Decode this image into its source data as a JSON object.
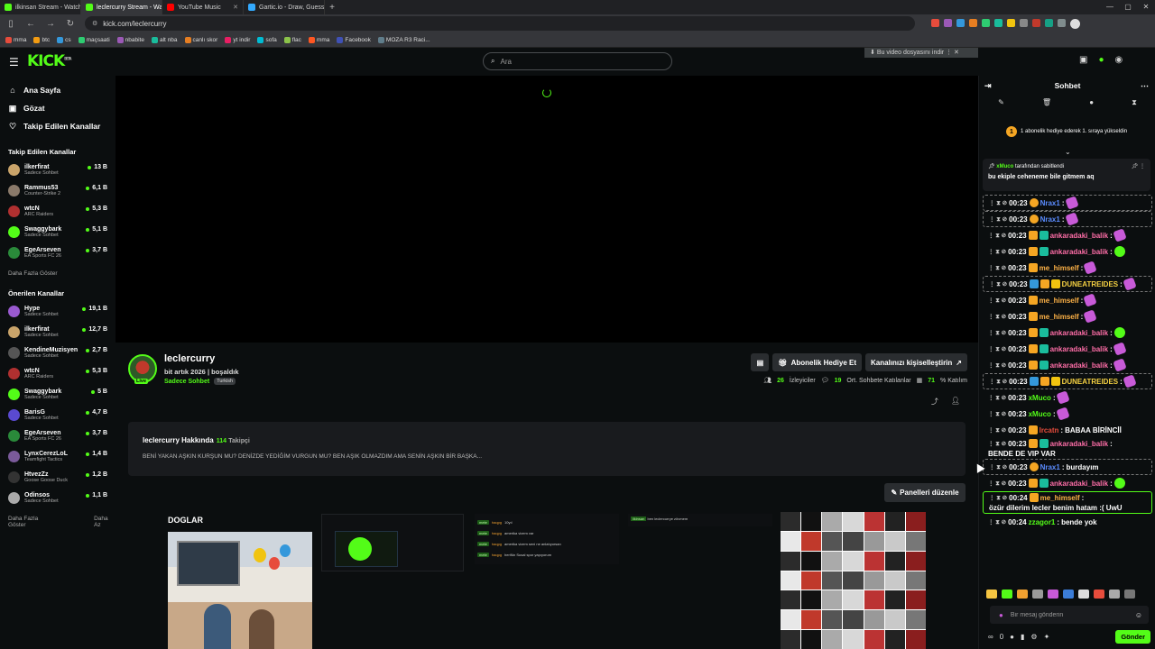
{
  "browser": {
    "tabs": [
      {
        "title": "ilkinsan Stream - Watch Live",
        "color": "#53fc18",
        "active": false
      },
      {
        "title": "leclercurry Stream - Watch",
        "color": "#53fc18",
        "active": true
      },
      {
        "title": "YouTube Music",
        "color": "#ff0000",
        "active": false
      },
      {
        "title": "Gartic.io - Draw, Guess, WI",
        "color": "#33aaff",
        "active": false
      }
    ],
    "url": "kick.com/leclercurry",
    "bookmarks": [
      "mma",
      "btc",
      "cs",
      "maçsaati",
      "nbabite",
      "alt nba",
      "canlı skor",
      "yt indir",
      "sofa",
      "flac",
      "mma",
      "Facebook",
      "MOZA R3 Raci..."
    ],
    "download_notice": "Bu video dosyasını indir"
  },
  "header": {
    "logo": "KICK",
    "logo_sup": "BETA",
    "search_placeholder": "Ara"
  },
  "sidebar": {
    "nav": [
      {
        "label": "Ana Sayfa",
        "icon": "home-icon",
        "glyph": "⌂"
      },
      {
        "label": "Gözat",
        "icon": "browse-icon",
        "glyph": "▣"
      },
      {
        "label": "Takip Edilen Kanallar",
        "icon": "heart-icon",
        "glyph": "♡"
      }
    ],
    "followed_title": "Takip Edilen Kanallar",
    "followed": [
      {
        "name": "ilkerfirat",
        "cat": "Sadece Sohbet",
        "viewers": "13 B",
        "color": "#c9a46a"
      },
      {
        "name": "Rammus53",
        "cat": "Counter-Strike 2",
        "viewers": "6,1 B",
        "color": "#8a7a6a"
      },
      {
        "name": "wtcN",
        "cat": "ARC Raiders",
        "viewers": "5,3 B",
        "color": "#b03030"
      },
      {
        "name": "Swaggybark",
        "cat": "Sadece Sohbet",
        "viewers": "5,1 B",
        "color": "#53fc18"
      },
      {
        "name": "EgeArseven",
        "cat": "EA Sports FC 26",
        "viewers": "3,7 B",
        "color": "#2a8a3a"
      }
    ],
    "show_more": "Daha Fazla Göster",
    "recommended_title": "Önerilen Kanallar",
    "recommended": [
      {
        "name": "Hype",
        "cat": "Sadece Sohbet",
        "viewers": "19,1 B",
        "color": "#9a5ad0"
      },
      {
        "name": "ilkerfirat",
        "cat": "Sadece Sohbet",
        "viewers": "12,7 B",
        "color": "#c9a46a"
      },
      {
        "name": "KendineMuzisyen",
        "cat": "Sadece Sohbet",
        "viewers": "2,7 B",
        "color": "#555555"
      },
      {
        "name": "wtcN",
        "cat": "ARC Raiders",
        "viewers": "5,3 B",
        "color": "#b03030"
      },
      {
        "name": "Swaggybark",
        "cat": "Sadece Sohbet",
        "viewers": "5 B",
        "color": "#53fc18"
      },
      {
        "name": "BarisG",
        "cat": "Sadece Sohbet",
        "viewers": "4,7 B",
        "color": "#5a4ad0"
      },
      {
        "name": "EgeArseven",
        "cat": "EA Sports FC 26",
        "viewers": "3,7 B",
        "color": "#2a8a3a"
      },
      {
        "name": "LynxCerezLoL",
        "cat": "Teamfight Tactics",
        "viewers": "1,4 B",
        "color": "#7a5a9a"
      },
      {
        "name": "HtvezZz",
        "cat": "Goose Goose Duck",
        "viewers": "1,2 B",
        "color": "#333333"
      },
      {
        "name": "Odinsos",
        "cat": "Sadece Sohbet",
        "viewers": "1,1 B",
        "color": "#aaaaaa"
      }
    ],
    "show_more2": "Daha Fazla Göster",
    "show_less": "Daha Az"
  },
  "channel": {
    "name": "leclercurry",
    "live": "Live",
    "stream_title": "bit artık 2026 | boşaldık",
    "category": "Sadece Sohbet",
    "tag": "Turkish",
    "buttons": {
      "gift": "Abonelik Hediye Et",
      "customize": "Kanalınızı kişiselleştirin"
    },
    "stats": {
      "viewers": "26",
      "viewers_label": "İzleyiciler",
      "chatters": "19",
      "chatters_label": "Ort. Sohbete Katılanlar",
      "participation": "71",
      "participation_label": "% Katılım"
    },
    "about_title": "leclercurry Hakkında",
    "followers": "114",
    "followers_label": "Takipçi",
    "about_text": "BENİ YAKAN AŞKIN KURŞUN MU? DENİZDE YEDİĞİM VURGUN MU? BEN AŞIK OLMAZDIM AMA SENİN AŞKIN BİR BAŞKA...",
    "panels_button": "Panelleri düzenle",
    "panel_title": "DOGLAR"
  },
  "panel_chat": [
    {
      "user": "mete",
      "who": "haqpg",
      "text": "10yıl"
    },
    {
      "user": "mete",
      "who": "haqpg",
      "text": "amerika vizem var"
    },
    {
      "user": "mete",
      "who": "haqpg",
      "text": "amerika vizem seni ne anlatıyorsan"
    },
    {
      "user": "mete",
      "who": "haqpg",
      "text": "herifün Susal spor yapıyorum"
    }
  ],
  "panel_line": {
    "user": "ilkinsan",
    "text": "ben leclercurrye zövmem"
  },
  "chat": {
    "title": "Sohbet",
    "gift_notice": "1 abonelik hediye ederek 1. sıraya yükseldin",
    "gift_rank": "1",
    "pinned_by_user": "xMuco",
    "pinned_by_suffix": "tarafından sabitlendi",
    "pinned_text": "bu ekiple ceheneme bile gitmem aq",
    "messages": [
      {
        "time": "00:23",
        "badges": [
          "b-sub"
        ],
        "user": "Nrax1",
        "ucolor": "#5b8cff",
        "text": "",
        "emotes": [
          "e-p"
        ],
        "style": "boxed"
      },
      {
        "time": "00:23",
        "badges": [
          "b-sub"
        ],
        "user": "Nrax1",
        "ucolor": "#5b8cff",
        "text": "",
        "emotes": [
          "e-p"
        ],
        "style": "boxed"
      },
      {
        "time": "00:23",
        "badges": [
          "b-crown",
          "b-vip"
        ],
        "user": "ankaradaki_balik",
        "ucolor": "#ff6ea8",
        "text": "",
        "emotes": [
          "e-p"
        ],
        "style": ""
      },
      {
        "time": "00:23",
        "badges": [
          "b-crown",
          "b-vip"
        ],
        "user": "ankaradaki_balik",
        "ucolor": "#ff6ea8",
        "text": "",
        "emotes": [
          "e-g"
        ],
        "style": ""
      },
      {
        "time": "00:23",
        "badges": [
          "b-crown"
        ],
        "user": "me_himself",
        "ucolor": "#ffb347",
        "text": "",
        "emotes": [
          "e-p"
        ],
        "style": ""
      },
      {
        "time": "00:23",
        "badges": [
          "b-mod",
          "b-crown",
          "b-y"
        ],
        "user": "DUNEATREIDES",
        "ucolor": "#f5d142",
        "text": "",
        "emotes": [
          "e-p"
        ],
        "style": "boxed"
      },
      {
        "time": "00:23",
        "badges": [
          "b-crown"
        ],
        "user": "me_himself",
        "ucolor": "#ffb347",
        "text": "",
        "emotes": [
          "e-p"
        ],
        "style": ""
      },
      {
        "time": "00:23",
        "badges": [
          "b-crown"
        ],
        "user": "me_himself",
        "ucolor": "#ffb347",
        "text": "",
        "emotes": [
          "e-p"
        ],
        "style": ""
      },
      {
        "time": "00:23",
        "badges": [
          "b-crown",
          "b-vip"
        ],
        "user": "ankaradaki_balik",
        "ucolor": "#ff6ea8",
        "text": "",
        "emotes": [
          "e-g"
        ],
        "style": ""
      },
      {
        "time": "00:23",
        "badges": [
          "b-crown",
          "b-vip"
        ],
        "user": "ankaradaki_balik",
        "ucolor": "#ff6ea8",
        "text": "",
        "emotes": [
          "e-p"
        ],
        "style": ""
      },
      {
        "time": "00:23",
        "badges": [
          "b-crown",
          "b-vip"
        ],
        "user": "ankaradaki_balik",
        "ucolor": "#ff6ea8",
        "text": "",
        "emotes": [
          "e-p"
        ],
        "style": ""
      },
      {
        "time": "00:23",
        "badges": [
          "b-mod",
          "b-crown",
          "b-y"
        ],
        "user": "DUNEATREIDES",
        "ucolor": "#f5d142",
        "text": "",
        "emotes": [
          "e-p"
        ],
        "style": "boxed"
      },
      {
        "time": "00:23",
        "badges": [],
        "user": "xMuco",
        "ucolor": "#53fc18",
        "text": "",
        "emotes": [
          "e-p"
        ],
        "style": ""
      },
      {
        "time": "00:23",
        "badges": [],
        "user": "xMuco",
        "ucolor": "#53fc18",
        "text": "",
        "emotes": [
          "e-p"
        ],
        "style": ""
      },
      {
        "time": "00:23",
        "badges": [
          "b-crown"
        ],
        "user": "Ircatn",
        "ucolor": "#e74c3c",
        "text": "BABAA BİRİNCİİ",
        "emotes": [],
        "style": ""
      },
      {
        "time": "00:23",
        "badges": [
          "b-crown",
          "b-vip"
        ],
        "user": "ankaradaki_balik",
        "ucolor": "#ff6ea8",
        "text": "BENDE DE VIP VAR",
        "emotes": [],
        "style": ""
      },
      {
        "time": "00:23",
        "badges": [
          "b-sub"
        ],
        "user": "Nrax1",
        "ucolor": "#5b8cff",
        "text": "burdayım",
        "emotes": [],
        "style": "boxed"
      },
      {
        "time": "00:23",
        "badges": [
          "b-crown",
          "b-vip"
        ],
        "user": "ankaradaki_balik",
        "ucolor": "#ff6ea8",
        "text": "",
        "emotes": [
          "e-g"
        ],
        "style": ""
      },
      {
        "time": "00:24",
        "badges": [
          "b-crown"
        ],
        "user": "me_himself",
        "ucolor": "#ffb347",
        "text": "özür dilerim lecler benim hatam :( UwU",
        "emotes": [],
        "style": "green"
      },
      {
        "time": "00:24",
        "badges": [],
        "user": "zzagor1",
        "ucolor": "#53fc18",
        "text": "bende yok",
        "emotes": [],
        "style": ""
      }
    ],
    "input_placeholder": "Bir mesaj gönderin",
    "points": "0",
    "send": "Gönder"
  }
}
